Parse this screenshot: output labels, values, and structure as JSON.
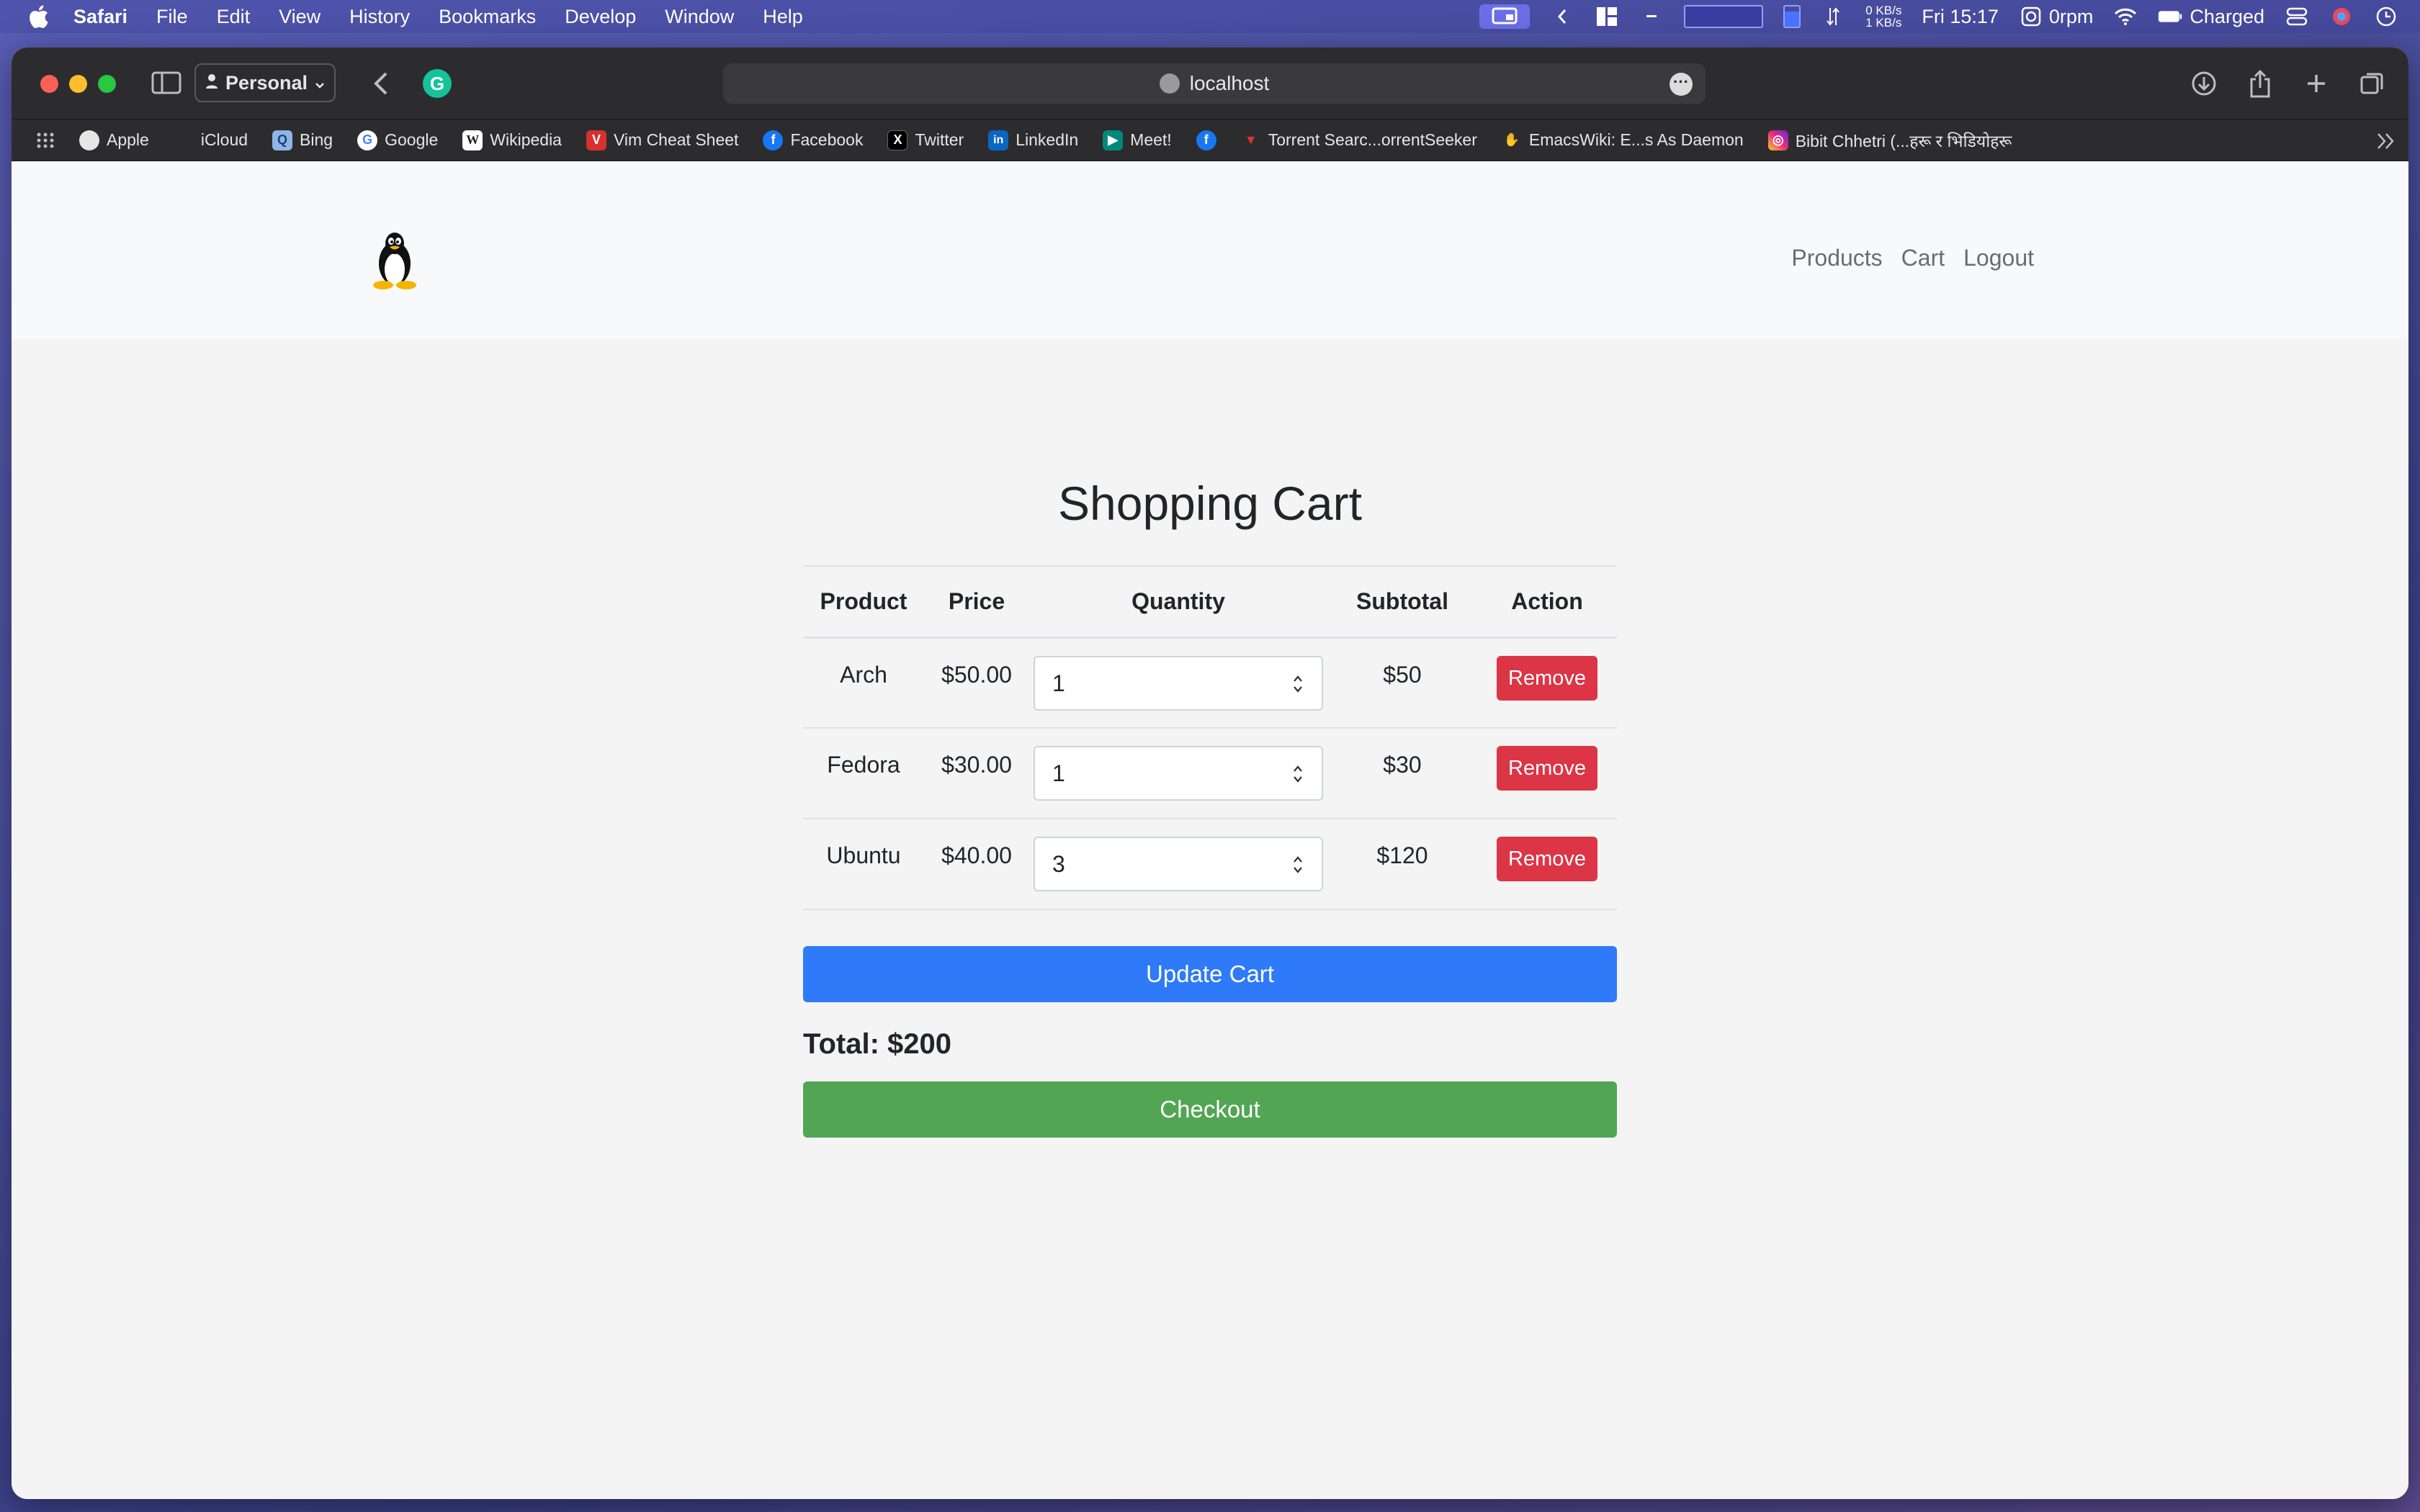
{
  "menubar": {
    "app_name": "Safari",
    "items": [
      "File",
      "Edit",
      "View",
      "History",
      "Bookmarks",
      "Develop",
      "Window",
      "Help"
    ],
    "status": {
      "net_down": "0 KB/s",
      "net_up": "1 KB/s",
      "clock": "Fri 15:17",
      "fan": "0rpm",
      "battery": "Charged"
    }
  },
  "browser": {
    "profile": "Personal",
    "url": "localhost",
    "bookmarks": [
      {
        "label": "Apple",
        "icon": "apple-icon",
        "color": "#cfcfcf"
      },
      {
        "label": "iCloud",
        "icon": "apple-icon",
        "color": "#cfcfcf"
      },
      {
        "label": "Bing",
        "icon": "bing-icon",
        "color": "#8fb4e8"
      },
      {
        "label": "Google",
        "icon": "google-icon",
        "color": "#ffffff"
      },
      {
        "label": "Wikipedia",
        "icon": "wikipedia-icon",
        "color": "#ffffff"
      },
      {
        "label": "Vim Cheat Sheet",
        "icon": "vim-icon",
        "color": "#d6312f"
      },
      {
        "label": "Facebook",
        "icon": "facebook-icon",
        "color": "#1877f2"
      },
      {
        "label": "Twitter",
        "icon": "x-icon",
        "color": "#000000"
      },
      {
        "label": "LinkedIn",
        "icon": "linkedin-icon",
        "color": "#0a66c2"
      },
      {
        "label": "Meet!",
        "icon": "meet-icon",
        "color": "#00897b"
      },
      {
        "label": "",
        "icon": "facebook-icon",
        "color": "#1877f2"
      },
      {
        "label": "Torrent Searc...orrentSeeker",
        "icon": "torrent-icon",
        "color": "#d9342b"
      },
      {
        "label": "EmacsWiki: E...s As Daemon",
        "icon": "emacswiki-icon",
        "color": "#a0733a"
      },
      {
        "label": "Bibit Chhetri (...हरू र भिडियोहरू",
        "icon": "instagram-icon",
        "color": "#e1306c"
      }
    ]
  },
  "site": {
    "nav": [
      "Products",
      "Cart",
      "Logout"
    ]
  },
  "cart": {
    "title": "Shopping Cart",
    "headers": [
      "Product",
      "Price",
      "Quantity",
      "Subtotal",
      "Action"
    ],
    "rows": [
      {
        "product": "Arch",
        "price": "$50.00",
        "quantity": "1",
        "subtotal": "$50",
        "action": "Remove"
      },
      {
        "product": "Fedora",
        "price": "$30.00",
        "quantity": "1",
        "subtotal": "$30",
        "action": "Remove"
      },
      {
        "product": "Ubuntu",
        "price": "$40.00",
        "quantity": "3",
        "subtotal": "$120",
        "action": "Remove"
      }
    ],
    "update_label": "Update Cart",
    "total_label": "Total: $200",
    "checkout_label": "Checkout"
  }
}
